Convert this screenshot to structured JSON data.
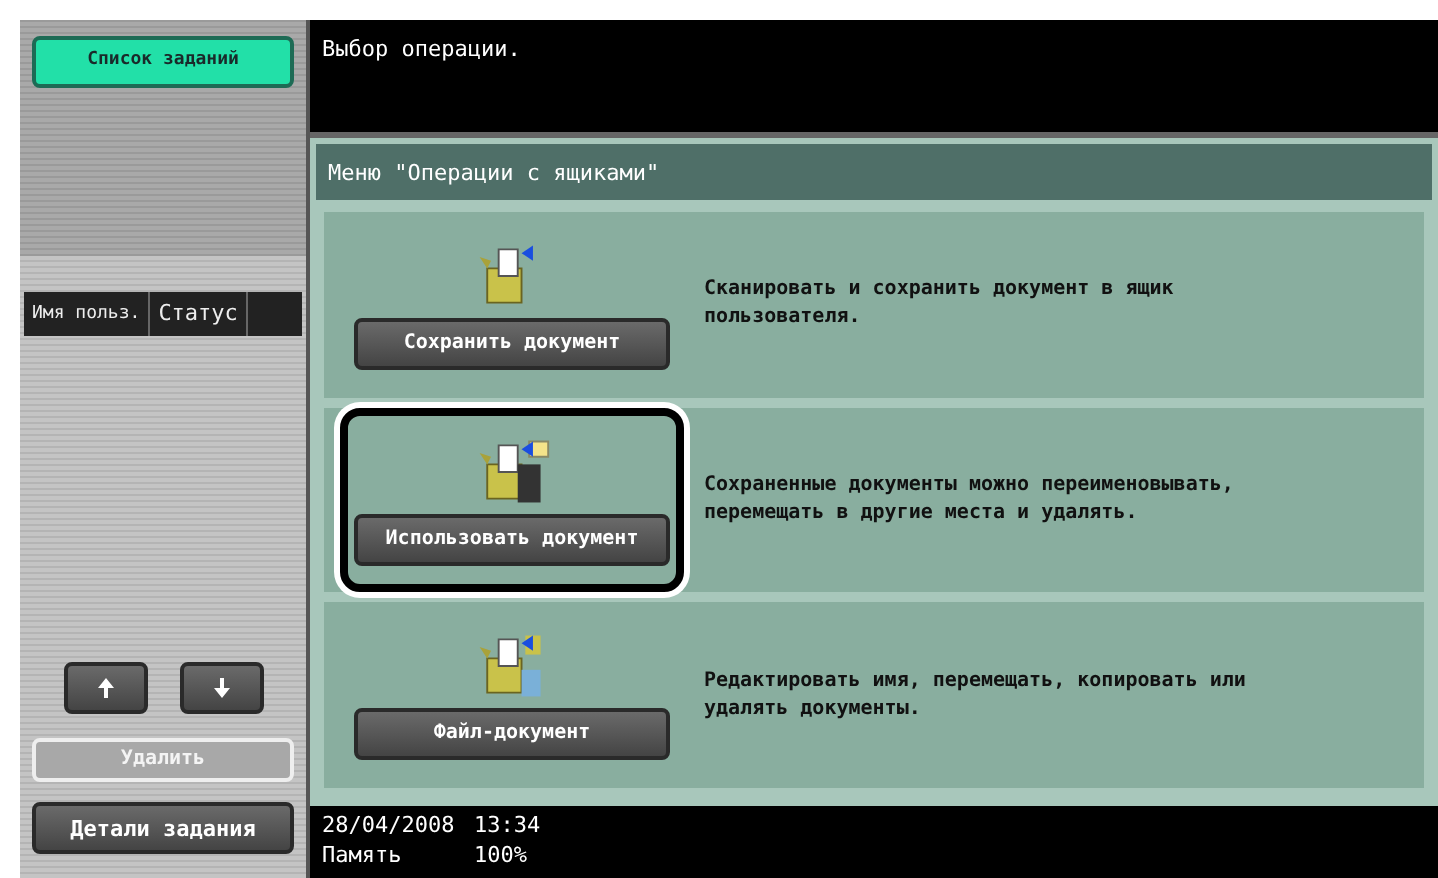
{
  "sidebar": {
    "job_list_button": "Список заданий",
    "columns": [
      "Имя польз.",
      "Статус"
    ],
    "scroll_buttons": [
      {
        "kind": "up"
      },
      {
        "kind": "down"
      }
    ],
    "delete_button": {
      "label": "Удалить",
      "disabled": true
    },
    "details_button": "Детали задания"
  },
  "header": {
    "message": "Выбор операции."
  },
  "menu": {
    "title": "Меню \"Операции с ящиками\"",
    "options": [
      {
        "kind": "save",
        "label": "Сохранить документ",
        "description": "Сканировать и сохранить документ в ящик пользователя.",
        "selected": false
      },
      {
        "kind": "use",
        "label": "Использовать документ",
        "description": "Сохраненные документы можно переименовывать, перемещать в другие места и удалять.",
        "selected": true
      },
      {
        "kind": "file",
        "label": "Файл-документ",
        "description": "Редактировать имя, перемещать, копировать или удалять документы.",
        "selected": false
      }
    ]
  },
  "status_bar": {
    "date": "28/04/2008",
    "time": "13:34",
    "memory_label": "Память",
    "memory_value": "100%"
  }
}
